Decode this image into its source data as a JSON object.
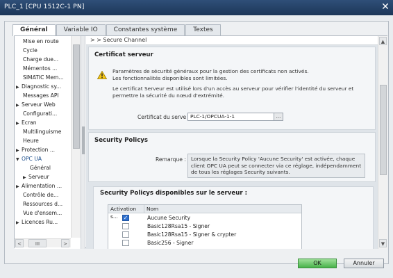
{
  "window": {
    "title": "PLC_1 [CPU 1512C-1 PN]",
    "close_glyph": "✕"
  },
  "tabs": [
    {
      "label": "Général",
      "active": true
    },
    {
      "label": "Variable IO",
      "active": false
    },
    {
      "label": "Constantes système",
      "active": false
    },
    {
      "label": "Textes",
      "active": false
    }
  ],
  "nav": {
    "items": [
      {
        "label": "Mise en route",
        "arrow": ""
      },
      {
        "label": "Cycle",
        "arrow": ""
      },
      {
        "label": "Charge due...",
        "arrow": ""
      },
      {
        "label": "Mémentos ...",
        "arrow": ""
      },
      {
        "label": "SIMATIC Mem...",
        "arrow": ""
      },
      {
        "label": "Diagnostic sy...",
        "arrow": "▶"
      },
      {
        "label": "Messages API",
        "arrow": ""
      },
      {
        "label": "Serveur Web",
        "arrow": "▶"
      },
      {
        "label": "Configurati...",
        "arrow": ""
      },
      {
        "label": "Ecran",
        "arrow": "▶"
      },
      {
        "label": "Multilinguisme",
        "arrow": ""
      },
      {
        "label": "Heure",
        "arrow": ""
      },
      {
        "label": "Protection ...",
        "arrow": "▶"
      },
      {
        "label": "OPC UA",
        "arrow": "▼"
      },
      {
        "label": "Général",
        "arrow": ""
      },
      {
        "label": "Serveur",
        "arrow": "▶"
      },
      {
        "label": "Alimentation ...",
        "arrow": "▶"
      },
      {
        "label": "Contrôle de...",
        "arrow": ""
      },
      {
        "label": "Ressources d...",
        "arrow": ""
      },
      {
        "label": "Vue d'ensem...",
        "arrow": ""
      },
      {
        "label": "Licences Ru...",
        "arrow": "▶"
      }
    ],
    "scroll_left": "<",
    "scroll_right": ">",
    "scroll_mid": "III"
  },
  "breadcrumb": "> > Secure Channel",
  "cert_section": {
    "title": "Certificat serveur",
    "warning_line1": "Paramètres de sécurité généraux pour la gestion des certificats non activés.",
    "warning_line2": "Les fonctionnalités disponibles sont limitées.",
    "info_line1": "Le certificat Serveur est utilisé lors d'un accès au serveur pour vérifier l'identité du serveur et",
    "info_line2": "permettre la sécurité du nœud d'extrémité.",
    "field_label": "Certificat du serve",
    "field_value": "PLC-1/OPCUA-1-1",
    "browse": "..."
  },
  "policy_section": {
    "title": "Security Policys",
    "remark_label": "Remarque :",
    "remark_line1": "Lorsque la Security Policy 'Aucune Security' est activée, chaque",
    "remark_line2": "client OPC UA peut se connecter via ce réglage, indépendamment",
    "remark_line3": "de tous les réglages Security suivants."
  },
  "available_section": {
    "title": "Security Policys disponibles sur le serveur :",
    "columns": [
      "Activation s...",
      "Nom"
    ],
    "rows": [
      {
        "checked": true,
        "name": "Aucune Security"
      },
      {
        "checked": false,
        "name": "Basic128Rsa15 - Signer"
      },
      {
        "checked": false,
        "name": "Basic128Rsa15 - Signer & crypter"
      },
      {
        "checked": false,
        "name": "Basic256 - Signer"
      }
    ]
  },
  "buttons": {
    "ok": "OK",
    "cancel": "Annuler"
  },
  "colors": {
    "titlebar": "#1c3658",
    "ok_button": "#48b24a",
    "selected_nav": "#1d4f8c",
    "checkbox_on": "#2d6fce"
  }
}
